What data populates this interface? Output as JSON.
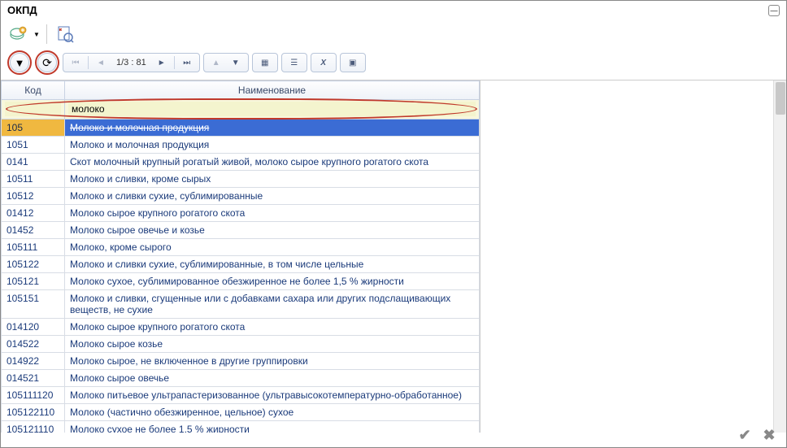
{
  "window": {
    "title": "ОКПД"
  },
  "nav": {
    "page_indicator": "1/3 : 81"
  },
  "filter": {
    "code_value": "",
    "name_value": "молоко"
  },
  "columns": {
    "code": "Код",
    "name": "Наименование"
  },
  "rows": [
    {
      "code": "105",
      "name": "Молоко и молочная продукция",
      "selected": true
    },
    {
      "code": "1051",
      "name": "Молоко и молочная продукция"
    },
    {
      "code": "0141",
      "name": "Скот молочный крупный рогатый живой, молоко сырое крупного рогатого скота"
    },
    {
      "code": "10511",
      "name": "Молоко и сливки, кроме сырых"
    },
    {
      "code": "10512",
      "name": "Молоко и сливки сухие, сублимированные"
    },
    {
      "code": "01412",
      "name": "Молоко сырое крупного рогатого скота"
    },
    {
      "code": "01452",
      "name": "Молоко сырое овечье и козье"
    },
    {
      "code": "105111",
      "name": "Молоко, кроме сырого"
    },
    {
      "code": "105122",
      "name": "Молоко и сливки сухие, сублимированные, в том числе цельные"
    },
    {
      "code": "105121",
      "name": "Молоко сухое, сублимированное обезжиренное не более 1,5 % жирности"
    },
    {
      "code": "105151",
      "name": "Молоко и сливки, сгущенные или с добавками сахара или других подслащивающих веществ, не сухие"
    },
    {
      "code": "014120",
      "name": "Молоко сырое крупного рогатого скота"
    },
    {
      "code": "014522",
      "name": "Молоко сырое козье"
    },
    {
      "code": "014922",
      "name": "Молоко сырое, не включенное в другие группировки"
    },
    {
      "code": "014521",
      "name": "Молоко сырое овечье"
    },
    {
      "code": "105111120",
      "name": "Молоко питьевое ультрапастеризованное (ультравысокотемпературно-обработанное)"
    },
    {
      "code": "105122110",
      "name": "Молоко (частично обезжиренное, цельное) сухое"
    },
    {
      "code": "105121110",
      "name": "Молоко сухое не более 1,5 % жирности"
    }
  ]
}
